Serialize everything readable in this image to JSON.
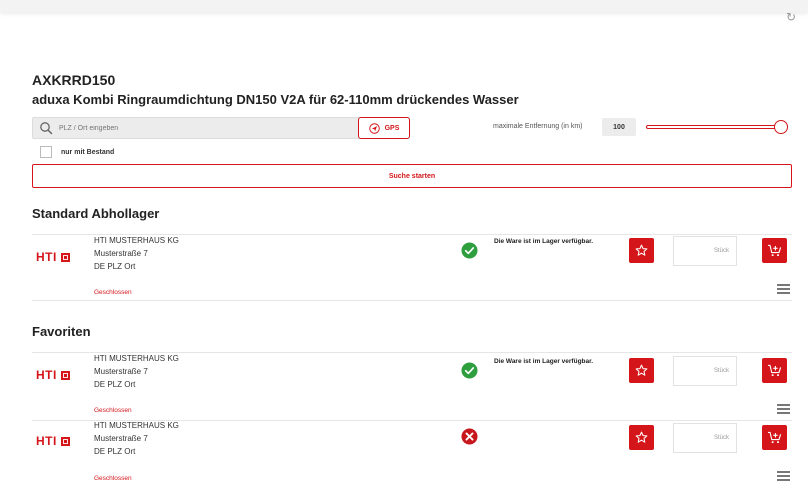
{
  "product": {
    "code": "AXKRRD150",
    "description": "aduxa Kombi Ringraumdichtung DN150 V2A für 62-110mm drückendes Wasser"
  },
  "search": {
    "placeholder": "PLZ / Ort eingeben",
    "value": "",
    "gps_label": "GPS",
    "distance_label": "maximale Entfernung (in km)",
    "distance_value": "100",
    "distance_slider_fraction": 1.0,
    "stock_only_label": "nur mit Bestand",
    "stock_only_checked": false,
    "start_label": "Suche starten"
  },
  "sections": {
    "standard_title": "Standard Abhollager",
    "favorites_title": "Favoriten"
  },
  "stores": [
    {
      "logo": "HTI",
      "name": "HTI MUSTERHAUS KG",
      "street": "Musterstraße 7",
      "city": "DE PLZ Ort",
      "hours": "Geschlossen",
      "status": "available",
      "status_icon": "check-circle-icon",
      "status_text": "Die Ware ist im Lager verfügbar.",
      "qty_placeholder": "Stück"
    },
    {
      "logo": "HTI",
      "name": "HTI MUSTERHAUS KG",
      "street": "Musterstraße 7",
      "city": "DE PLZ Ort",
      "hours": "Geschlossen",
      "status": "available",
      "status_icon": "check-circle-icon",
      "status_text": "Die Ware ist im Lager verfügbar.",
      "qty_placeholder": "Stück"
    },
    {
      "logo": "HTI",
      "name": "HTI MUSTERHAUS KG",
      "street": "Musterstraße 7",
      "city": "DE PLZ Ort",
      "hours": "Geschlossen",
      "status": "unavailable",
      "status_icon": "x-circle-icon",
      "status_text": "",
      "qty_placeholder": "Stück"
    }
  ],
  "colors": {
    "accent": "#d4151a",
    "available": "#2e9e3e",
    "unavailable": "#c8161d"
  }
}
